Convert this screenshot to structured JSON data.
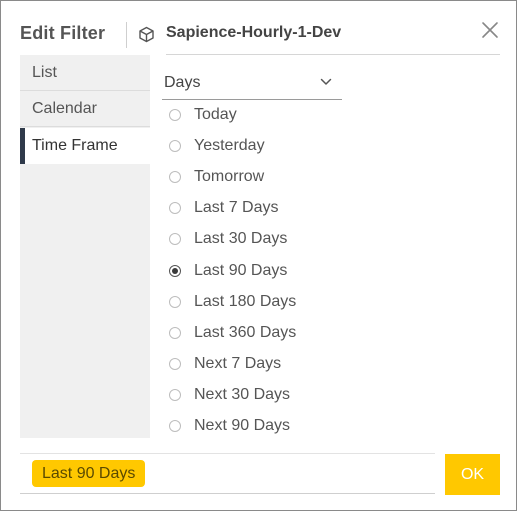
{
  "header": {
    "title": "Edit Filter",
    "datasource": "Sapience-Hourly-1-Dev"
  },
  "sidebar": {
    "items": [
      {
        "label": "List"
      },
      {
        "label": "Calendar"
      },
      {
        "label": "Time Frame",
        "active": true
      }
    ]
  },
  "unit_select": {
    "value": "Days"
  },
  "options": [
    {
      "label": "Today",
      "checked": false
    },
    {
      "label": "Yesterday",
      "checked": false
    },
    {
      "label": "Tomorrow",
      "checked": false
    },
    {
      "label": "Last 7 Days",
      "checked": false
    },
    {
      "label": "Last 30 Days",
      "checked": false
    },
    {
      "label": "Last 90 Days",
      "checked": true
    },
    {
      "label": "Last 180 Days",
      "checked": false
    },
    {
      "label": "Last 360 Days",
      "checked": false
    },
    {
      "label": "Next 7 Days",
      "checked": false
    },
    {
      "label": "Next 30 Days",
      "checked": false
    },
    {
      "label": "Next 90 Days",
      "checked": false
    }
  ],
  "footer": {
    "selected_tag": "Last 90 Days",
    "ok_label": "OK"
  },
  "colors": {
    "accent": "#ffc800",
    "active_marker": "#2f3a4a"
  },
  "icons": {
    "datasource": "cube-icon",
    "close": "close-icon",
    "dropdown": "chevron-down-icon"
  }
}
